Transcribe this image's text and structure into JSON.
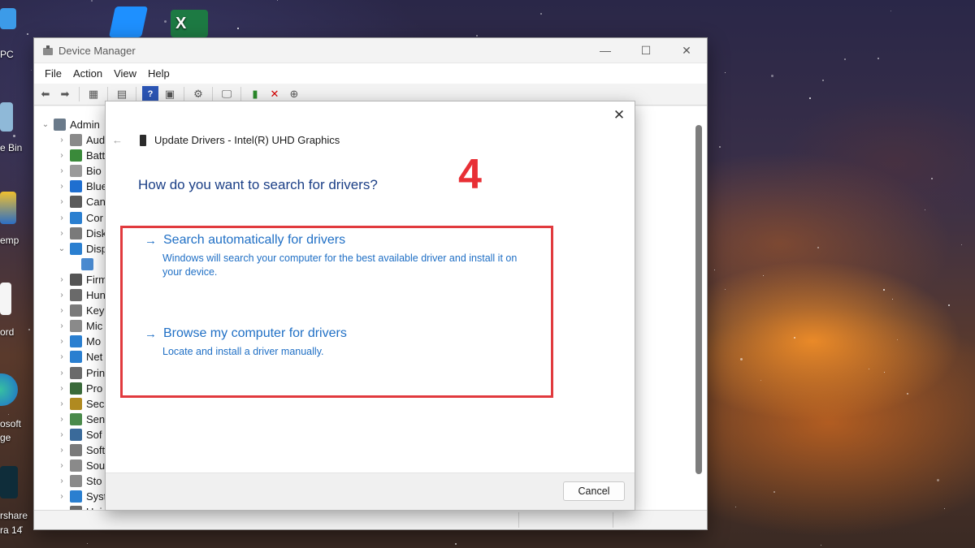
{
  "desktop": {
    "icons": [
      {
        "name": "this-pc",
        "label": "PC"
      },
      {
        "name": "recycle-bin",
        "label": "e Bin"
      },
      {
        "name": "temp-folder",
        "label": "emp"
      },
      {
        "name": "word-doc",
        "label": "ord"
      },
      {
        "name": "edge",
        "label_line1": "osoft",
        "label_line2": "ge"
      },
      {
        "name": "wondershare",
        "label_line1": "rshare",
        "label_line2": "ra 14"
      }
    ]
  },
  "device_manager": {
    "title": "Device Manager",
    "menu": [
      "File",
      "Action",
      "View",
      "Help"
    ],
    "tree": {
      "root": "Admin",
      "items": [
        "Aud",
        "Batt",
        "Bio",
        "Blue",
        "Can",
        "Cor",
        "Disk",
        "Disp",
        "",
        "Firm",
        "Hun",
        "Key",
        "Mic",
        "Mo",
        "Net",
        "Prin",
        "Pro",
        "Sec",
        "Sen",
        "Sof",
        "Soft",
        "Sou",
        "Sto",
        "Syst",
        "Univ"
      ]
    }
  },
  "dialog": {
    "header": "Update Drivers - Intel(R) UHD Graphics",
    "question": "How do you want to search for drivers?",
    "step_number": "4",
    "option_auto": {
      "title": "Search automatically for drivers",
      "description": "Windows will search your computer for the best available driver and install it on your device."
    },
    "option_browse": {
      "title": "Browse my computer for drivers",
      "description": "Locate and install a driver manually."
    },
    "cancel_label": "Cancel"
  },
  "colors": {
    "link_blue": "#1f6fc5",
    "question_blue": "#1b3f86",
    "highlight_red": "#e13a3e",
    "step_red": "#e82f35"
  }
}
